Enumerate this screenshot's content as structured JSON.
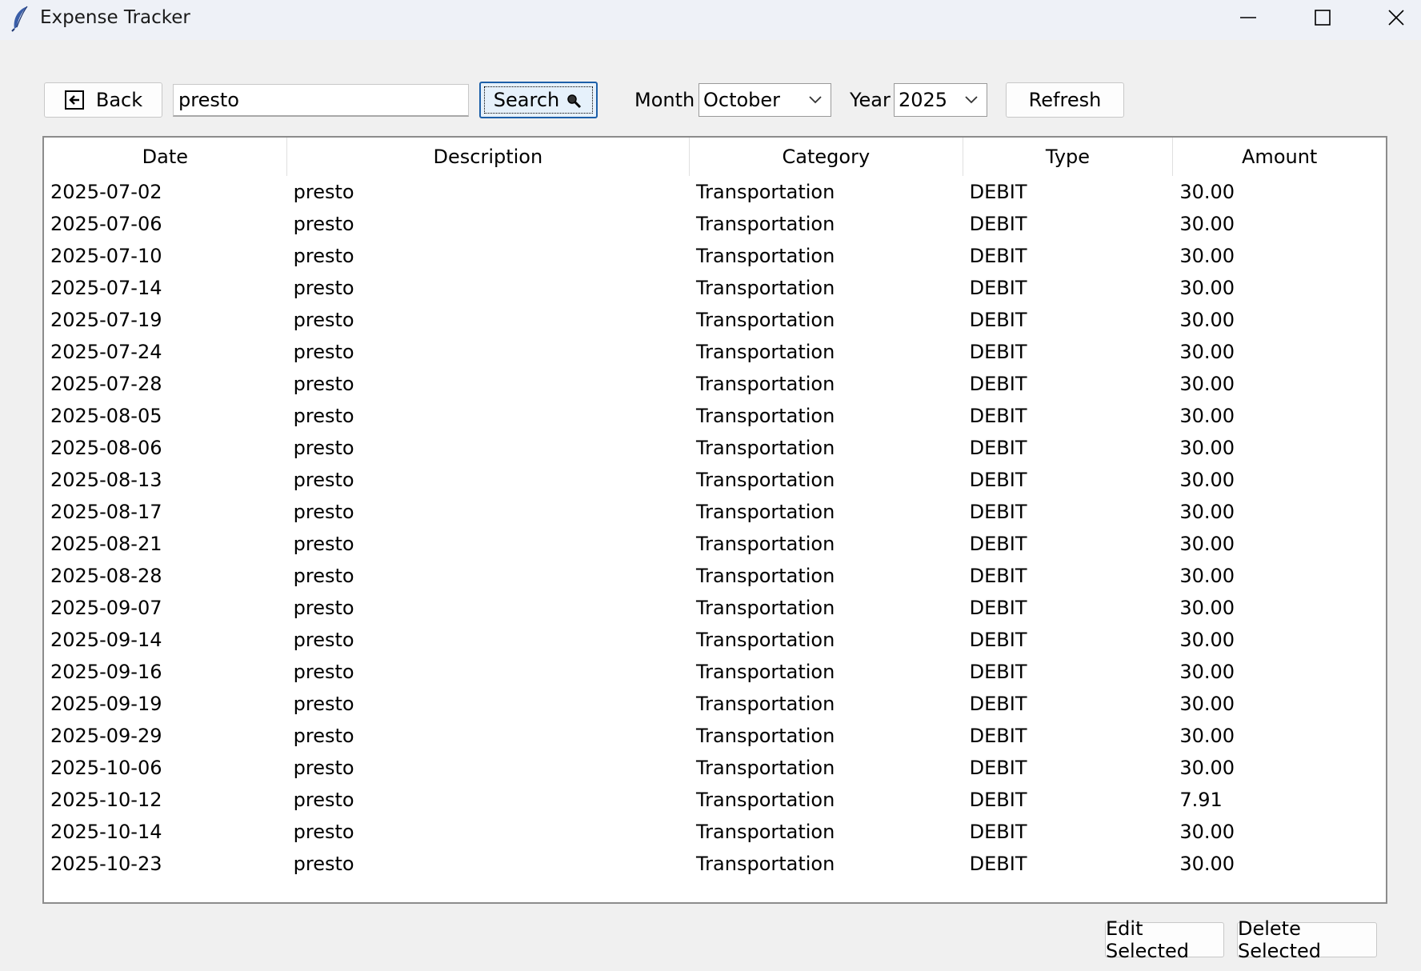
{
  "window": {
    "title": "Expense Tracker",
    "icons": {
      "app": "feather-icon",
      "minimize": "minimize-icon",
      "maximize": "maximize-icon",
      "close": "close-icon"
    }
  },
  "toolbar": {
    "back_label": "Back",
    "back_icon": "back-arrow-icon",
    "search_value": "presto",
    "search_label": "Search",
    "search_icon": "magnifier-icon",
    "month_label": "Month",
    "month_value": "October",
    "year_label": "Year",
    "year_value": "2025",
    "refresh_label": "Refresh"
  },
  "table": {
    "columns": [
      "Date",
      "Description",
      "Category",
      "Type",
      "Amount"
    ],
    "rows": [
      [
        "2025-07-02",
        "presto",
        "Transportation",
        "DEBIT",
        "30.00"
      ],
      [
        "2025-07-06",
        "presto",
        "Transportation",
        "DEBIT",
        "30.00"
      ],
      [
        "2025-07-10",
        "presto",
        "Transportation",
        "DEBIT",
        "30.00"
      ],
      [
        "2025-07-14",
        "presto",
        "Transportation",
        "DEBIT",
        "30.00"
      ],
      [
        "2025-07-19",
        "presto",
        "Transportation",
        "DEBIT",
        "30.00"
      ],
      [
        "2025-07-24",
        "presto",
        "Transportation",
        "DEBIT",
        "30.00"
      ],
      [
        "2025-07-28",
        "presto",
        "Transportation",
        "DEBIT",
        "30.00"
      ],
      [
        "2025-08-05",
        "presto",
        "Transportation",
        "DEBIT",
        "30.00"
      ],
      [
        "2025-08-06",
        "presto",
        "Transportation",
        "DEBIT",
        "30.00"
      ],
      [
        "2025-08-13",
        "presto",
        "Transportation",
        "DEBIT",
        "30.00"
      ],
      [
        "2025-08-17",
        "presto",
        "Transportation",
        "DEBIT",
        "30.00"
      ],
      [
        "2025-08-21",
        "presto",
        "Transportation",
        "DEBIT",
        "30.00"
      ],
      [
        "2025-08-28",
        "presto",
        "Transportation",
        "DEBIT",
        "30.00"
      ],
      [
        "2025-09-07",
        "presto",
        "Transportation",
        "DEBIT",
        "30.00"
      ],
      [
        "2025-09-14",
        "presto",
        "Transportation",
        "DEBIT",
        "30.00"
      ],
      [
        "2025-09-16",
        "presto",
        "Transportation",
        "DEBIT",
        "30.00"
      ],
      [
        "2025-09-19",
        "presto",
        "Transportation",
        "DEBIT",
        "30.00"
      ],
      [
        "2025-09-29",
        "presto",
        "Transportation",
        "DEBIT",
        "30.00"
      ],
      [
        "2025-10-06",
        "presto",
        "Transportation",
        "DEBIT",
        "30.00"
      ],
      [
        "2025-10-12",
        "presto",
        "Transportation",
        "DEBIT",
        "7.91"
      ],
      [
        "2025-10-14",
        "presto",
        "Transportation",
        "DEBIT",
        "30.00"
      ],
      [
        "2025-10-23",
        "presto",
        "Transportation",
        "DEBIT",
        "30.00"
      ]
    ]
  },
  "actions": {
    "edit_label": "Edit Selected",
    "delete_label": "Delete Selected"
  },
  "colors": {
    "window_bg": "#f0f0f0",
    "titlebar_bg": "#eef1f7",
    "focus_border": "#1c5fa8",
    "focus_fill": "#e6f1fb"
  }
}
